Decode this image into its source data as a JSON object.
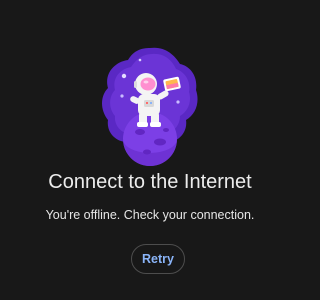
{
  "offline": {
    "illustration_icon": "astronaut-on-planet-icon",
    "title": "Connect to the Internet",
    "message": "You're offline. Check your connection.",
    "retry_label": "Retry"
  },
  "colors": {
    "background": "#181818",
    "title_text": "#ececec",
    "accent": "#8ab4f8",
    "planet_purple": "#6a2fd0",
    "button_border": "#4d4d4d"
  }
}
